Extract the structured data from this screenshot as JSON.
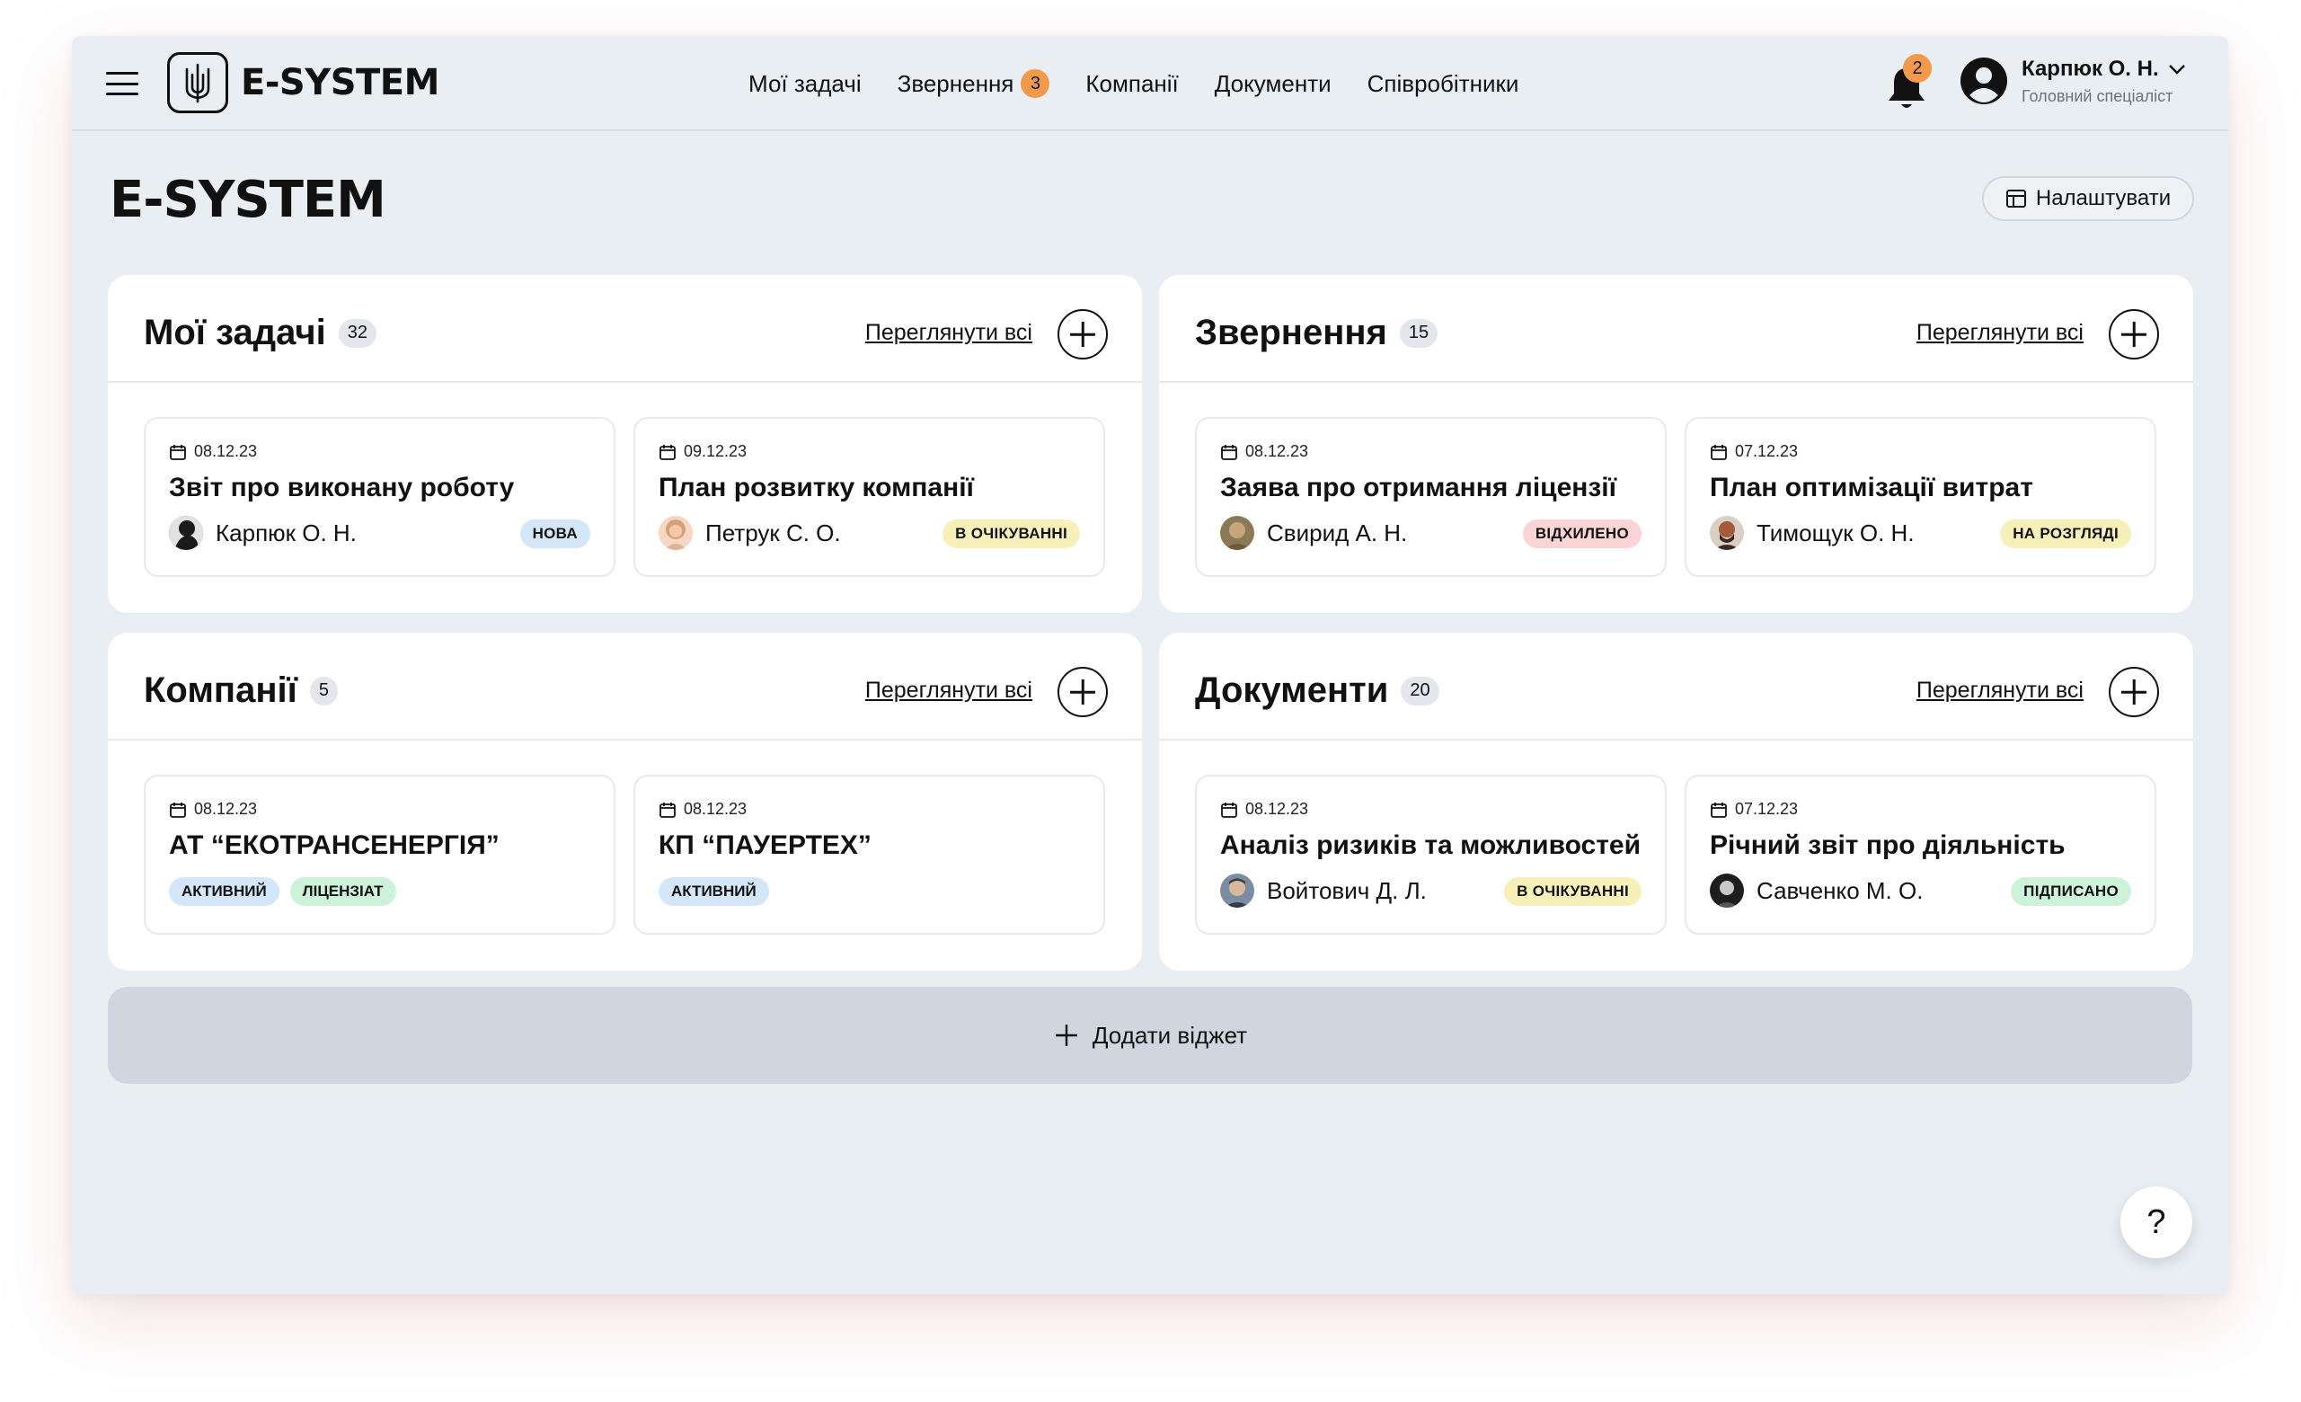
{
  "app": {
    "logo_text": "E-SYSTEM"
  },
  "nav": {
    "items": [
      {
        "label": "Мої задачі"
      },
      {
        "label": "Звернення",
        "badge": "3"
      },
      {
        "label": "Компанії"
      },
      {
        "label": "Документи"
      },
      {
        "label": "Співробітники"
      }
    ]
  },
  "notifications": {
    "count": "2",
    "icon": "bell-icon"
  },
  "user": {
    "name": "Карпюк О. Н.",
    "role": "Головний спеціаліст"
  },
  "page": {
    "title": "E-SYSTEM",
    "settings_label": "Налаштувати"
  },
  "widgets": [
    {
      "title": "Мої задачі",
      "count": "32",
      "view_all": "Переглянути всі",
      "cards": [
        {
          "date": "08.12.23",
          "title": "Звіт про виконану роботу",
          "person": "Карпюк О. Н.",
          "status": "НОВА",
          "status_color": "#d3e7f9"
        },
        {
          "date": "09.12.23",
          "title": "План розвитку компанії",
          "person": "Петрук С. О.",
          "status": "В ОЧІКУВАННІ",
          "status_color": "#f7f0b8"
        }
      ]
    },
    {
      "title": "Звернення",
      "count": "15",
      "view_all": "Переглянути всі",
      "cards": [
        {
          "date": "08.12.23",
          "title": "Заява про отримання ліцензії",
          "person": "Свирид А. Н.",
          "status": "ВІДХИЛЕНО",
          "status_color": "#fbd5d5"
        },
        {
          "date": "07.12.23",
          "title": "План оптимізації витрат",
          "person": "Тимощук О. Н.",
          "status": "НА РОЗГЛЯДІ",
          "status_color": "#f7f0b8"
        }
      ]
    },
    {
      "title": "Компанії",
      "count": "5",
      "view_all": "Переглянути всі",
      "cards": [
        {
          "date": "08.12.23",
          "title": "АТ “ЕКОТРАНСЕНЕРГІЯ”",
          "tags": [
            "АКТИВНИЙ",
            "ЛІЦЕНЗІАТ"
          ]
        },
        {
          "date": "08.12.23",
          "title": "КП “ПАУЕРТЕХ”",
          "tags": [
            "АКТИВНИЙ"
          ]
        }
      ]
    },
    {
      "title": "Документи",
      "count": "20",
      "view_all": "Переглянути всі",
      "cards": [
        {
          "date": "08.12.23",
          "title": "Аналіз ризиків та можливостей",
          "person": "Войтович Д. Л.",
          "status": "В ОЧІКУВАННІ",
          "status_color": "#f7f0b8"
        },
        {
          "date": "07.12.23",
          "title": "Річний звіт про діяльність",
          "person": "Савченко М. О.",
          "status": "ПІДПИСАНО",
          "status_color": "#cdf2da"
        }
      ]
    }
  ],
  "add_widget_label": "Додати віджет",
  "help_label": "?"
}
